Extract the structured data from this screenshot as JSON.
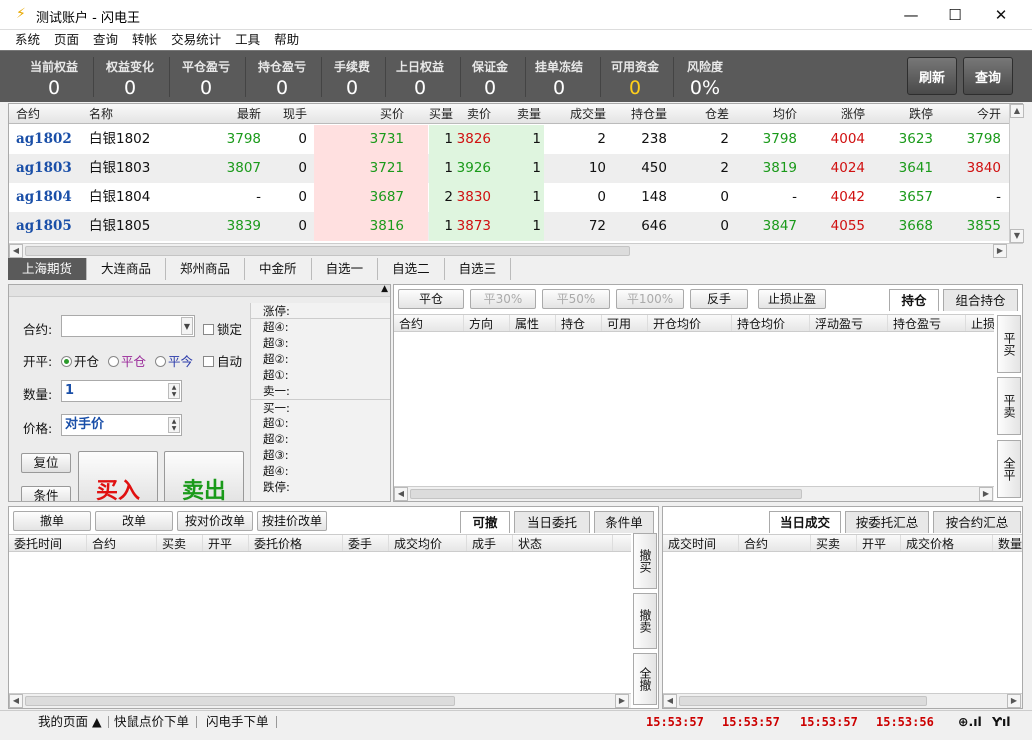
{
  "window": {
    "title": "测试账户 - 闪电王"
  },
  "menu": [
    "系统",
    "页面",
    "查询",
    "转帐",
    "交易统计",
    "工具",
    "帮助"
  ],
  "stats": [
    {
      "label": "当前权益",
      "value": "0"
    },
    {
      "label": "权益变化",
      "value": "0"
    },
    {
      "label": "平仓盈亏",
      "value": "0"
    },
    {
      "label": "持仓盈亏",
      "value": "0"
    },
    {
      "label": "手续费",
      "value": "0"
    },
    {
      "label": "上日权益",
      "value": "0"
    },
    {
      "label": "保证金",
      "value": "0"
    },
    {
      "label": "挂单冻结",
      "value": "0"
    },
    {
      "label": "可用资金",
      "value": "0"
    },
    {
      "label": "风险度",
      "value": "0%"
    }
  ],
  "stat_buttons": {
    "refresh": "刷新",
    "query": "查询"
  },
  "quote": {
    "headers": [
      "合约",
      "名称",
      "最新",
      "现手",
      "买价",
      "买量",
      "卖价",
      "卖量",
      "成交量",
      "持仓量",
      "仓差",
      "均价",
      "涨停",
      "跌停",
      "今开"
    ],
    "rows": [
      [
        "ag1802",
        "白银1802",
        "3798",
        "0",
        "3731",
        "1",
        "3826",
        "1",
        "2",
        "238",
        "2",
        "3798",
        "4004",
        "3623",
        "3798"
      ],
      [
        "ag1803",
        "白银1803",
        "3807",
        "0",
        "3721",
        "1",
        "3926",
        "1",
        "10",
        "450",
        "2",
        "3819",
        "4024",
        "3641",
        "3840"
      ],
      [
        "ag1804",
        "白银1804",
        "-",
        "0",
        "3687",
        "2",
        "3830",
        "1",
        "0",
        "148",
        "0",
        "-",
        "4042",
        "3657",
        "-"
      ],
      [
        "ag1805",
        "白银1805",
        "3839",
        "0",
        "3816",
        "1",
        "3873",
        "1",
        "72",
        "646",
        "0",
        "3847",
        "4055",
        "3668",
        "3855"
      ]
    ]
  },
  "exchange_tabs": [
    "上海期货",
    "大连商品",
    "郑州商品",
    "中金所",
    "自选一",
    "自选二",
    "自选三"
  ],
  "order": {
    "contract_label": "合约:",
    "lock_label": "锁定",
    "openclose_label": "开平:",
    "open": "开仓",
    "close": "平仓",
    "close_today": "平今",
    "auto": "自动",
    "qty_label": "数量:",
    "qty_value": "1",
    "price_label": "价格:",
    "price_value": "对手价",
    "reset": "复位",
    "condition": "条件",
    "buy": "买入",
    "sell": "卖出"
  },
  "depth": [
    "涨停:",
    "超④:",
    "超③:",
    "超②:",
    "超①:",
    "卖一:",
    "买一:",
    "超①:",
    "超②:",
    "超③:",
    "超④:",
    "跌停:"
  ],
  "position": {
    "buttons": [
      "平仓",
      "平30%",
      "平50%",
      "平100%",
      "反手",
      "止损止盈"
    ],
    "tabs": [
      "持仓",
      "组合持仓"
    ],
    "headers": [
      "合约",
      "方向",
      "属性",
      "持仓",
      "可用",
      "开仓均价",
      "持仓均价",
      "浮动盈亏",
      "持仓盈亏",
      "止损"
    ],
    "side": [
      "平买",
      "平卖",
      "全平"
    ]
  },
  "orders": {
    "buttons": [
      "撤单",
      "改单",
      "按对价改单",
      "按挂价改单"
    ],
    "tabs": [
      "可撤",
      "当日委托",
      "条件单"
    ],
    "headers": [
      "委托时间",
      "合约",
      "买卖",
      "开平",
      "委托价格",
      "委手",
      "成交均价",
      "成手",
      "状态"
    ],
    "side": [
      "撤买",
      "撤卖",
      "全撤"
    ]
  },
  "trades": {
    "tabs": [
      "当日成交",
      "按委托汇总",
      "按合约汇总"
    ],
    "headers": [
      "成交时间",
      "合约",
      "买卖",
      "开平",
      "成交价格",
      "数量"
    ]
  },
  "status": {
    "my_page": "我的页面 ▲",
    "quick": "快鼠点价下单",
    "flash": "闪电手下单",
    "times": [
      "15:53:57",
      "15:53:57",
      "15:53:57",
      "15:53:56"
    ]
  },
  "colors": {
    "buy_bg": "#ffe0e0",
    "sell_bg": "#dff5df",
    "up": "#d01010",
    "down": "#1a9a1a",
    "accent_yellow": "#ffcf1a"
  }
}
